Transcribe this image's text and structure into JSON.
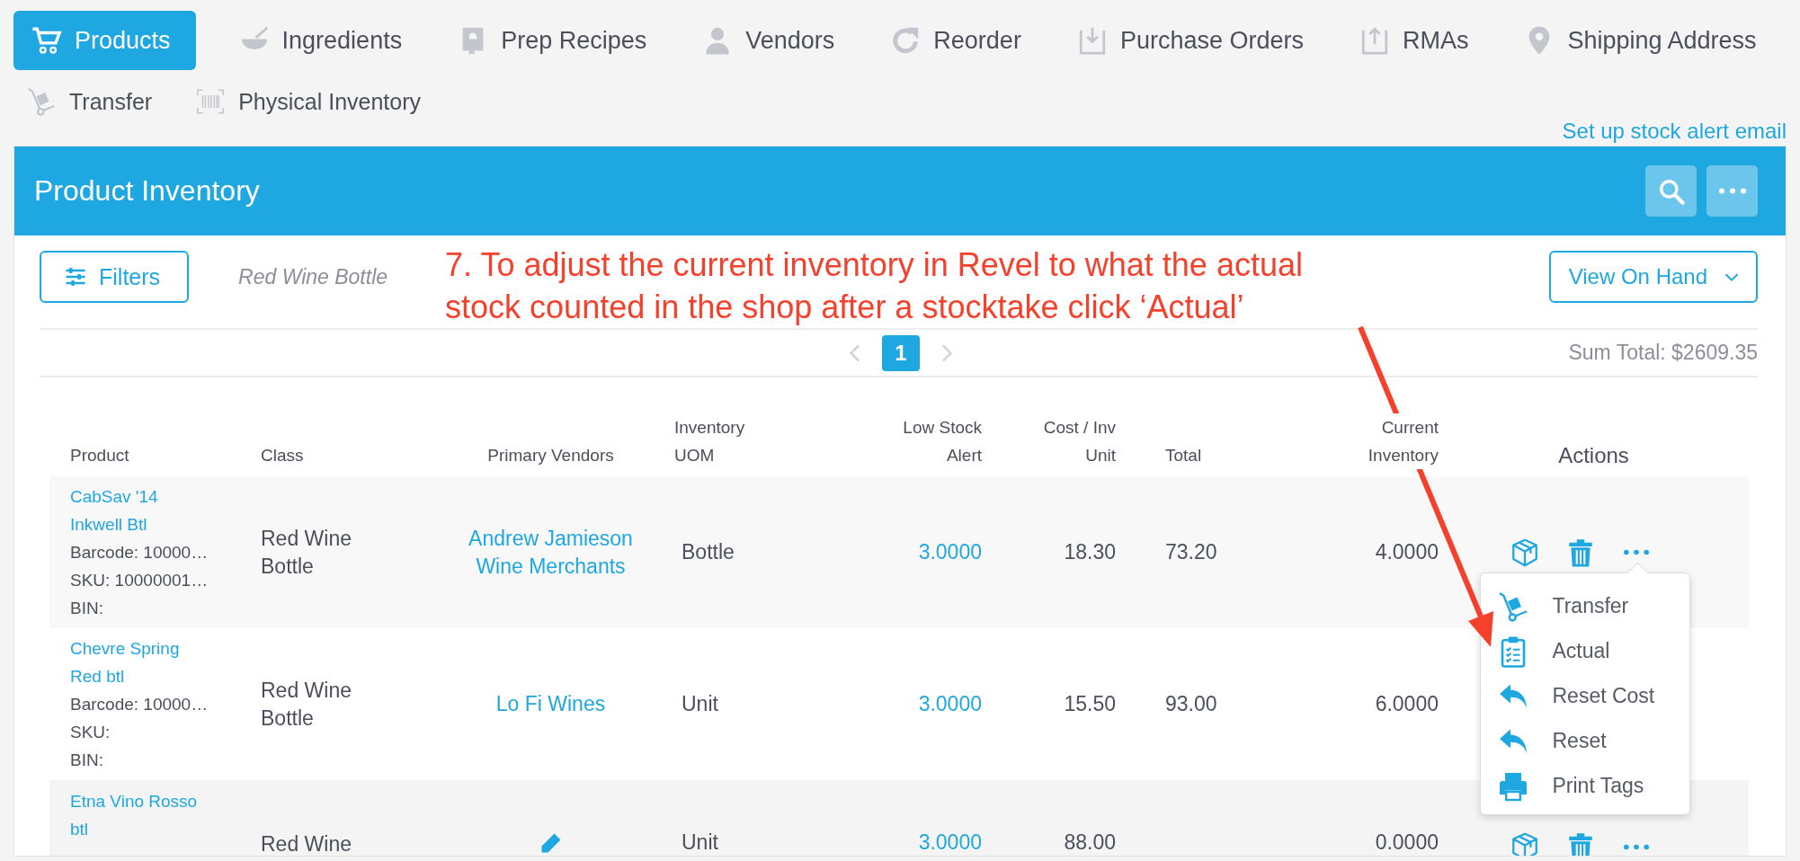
{
  "nav_tabs": [
    {
      "label": "Products",
      "selected": true
    },
    {
      "label": "Ingredients",
      "selected": false
    },
    {
      "label": "Prep Recipes",
      "selected": false
    },
    {
      "label": "Vendors",
      "selected": false
    },
    {
      "label": "Reorder",
      "selected": false
    },
    {
      "label": "Purchase Orders",
      "selected": false
    },
    {
      "label": "RMAs",
      "selected": false
    },
    {
      "label": "Shipping Address",
      "selected": false
    },
    {
      "label": "Transfer",
      "selected": false
    },
    {
      "label": "Physical Inventory",
      "selected": false
    }
  ],
  "stock_alert_link": "Set up stock alert email",
  "panel": {
    "title": "Product Inventory"
  },
  "filters_button": "Filters",
  "active_filter": "Red Wine Bottle",
  "view_select": "View On Hand",
  "annotation": "7. To adjust the current inventory in Revel to what the actual stock counted in the shop after a stocktake click ‘Actual’",
  "pagination": {
    "pages": [
      {
        "label": "1",
        "selected": true
      }
    ]
  },
  "sum_total": "Sum Total: $2609.35",
  "table": {
    "columns": [
      "Product",
      "Class",
      "Primary Vendors",
      "Inventory UOM",
      "Low Stock Alert",
      "Cost / Inv Unit",
      "Total",
      "Current Inventory",
      "Actions"
    ],
    "rows": [
      {
        "name": "CabSav '14 Inkwell Btl",
        "details": [
          "Barcode: 10000…",
          "SKU: 10000001…",
          "BIN:"
        ],
        "class": "Red Wine Bottle",
        "vendor": {
          "kind": "link",
          "text": "Andrew Jamieson Wine Merchants"
        },
        "uom": "Bottle",
        "low_stock_alert": "3.0000",
        "cost": "18.30",
        "total": "73.20",
        "current_inventory": "4.0000",
        "menu_open": true
      },
      {
        "name": "Chevre Spring Red btl",
        "details": [
          "Barcode: 10000…",
          "SKU:",
          "BIN:"
        ],
        "class": "Red Wine Bottle",
        "vendor": {
          "kind": "link",
          "text": "Lo Fi Wines"
        },
        "uom": "Unit",
        "low_stock_alert": "3.0000",
        "cost": "15.50",
        "total": "93.00",
        "current_inventory": "6.0000",
        "menu_open": false
      },
      {
        "name": "Etna Vino Rosso btl",
        "details": [],
        "class": "Red Wine",
        "vendor": {
          "kind": "edit"
        },
        "uom": "Unit",
        "low_stock_alert": "3.0000",
        "cost": "88.00",
        "total": "",
        "current_inventory": "0.0000",
        "menu_open": false
      }
    ]
  },
  "row_menu": {
    "items": [
      "Transfer",
      "Actual",
      "Reset Cost",
      "Reset",
      "Print Tags"
    ]
  }
}
